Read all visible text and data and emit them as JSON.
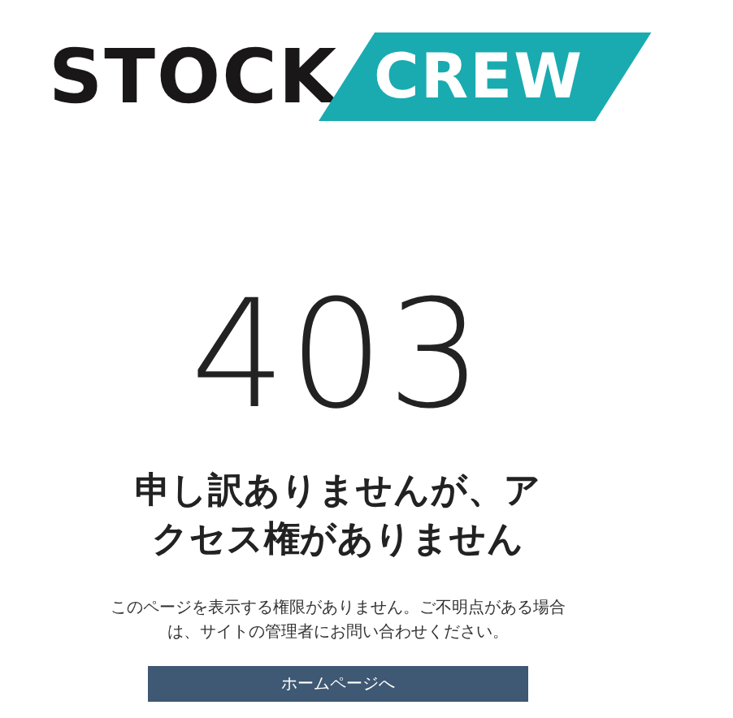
{
  "logo": {
    "word_1": "STOCK",
    "word_2": "CREW"
  },
  "error_code": "403",
  "heading": "申し訳ありませんが、アクセス権がありません",
  "message": "このページを表示する権限がありません。ご不明点がある場合は、サイトの管理者にお問い合わせください。",
  "button": "ホームページへ"
}
